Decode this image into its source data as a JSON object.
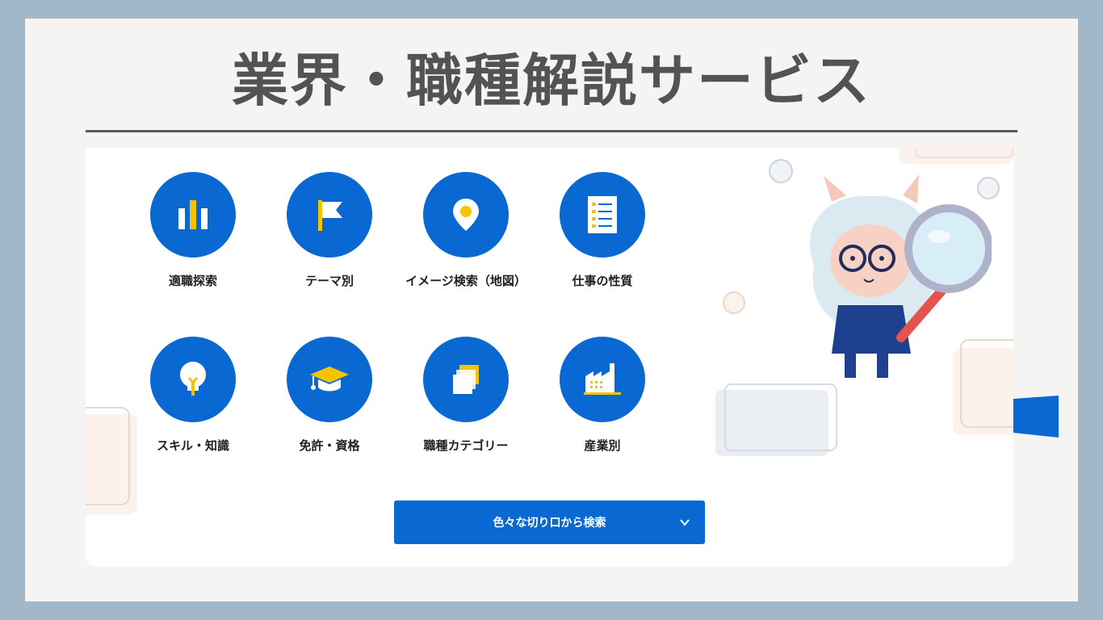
{
  "title": "業界・職種解説サービス",
  "tiles": [
    {
      "label": "適職探索",
      "icon": "bar-chart-icon"
    },
    {
      "label": "テーマ別",
      "icon": "flag-icon"
    },
    {
      "label": "イメージ検索（地図）",
      "icon": "map-pin-icon"
    },
    {
      "label": "仕事の性質",
      "icon": "checklist-icon"
    },
    {
      "label": "スキル・知識",
      "icon": "lightbulb-icon"
    },
    {
      "label": "免許・資格",
      "icon": "graduation-cap-icon"
    },
    {
      "label": "職種カテゴリー",
      "icon": "stacked-squares-icon"
    },
    {
      "label": "産業別",
      "icon": "factory-icon"
    }
  ],
  "cta": {
    "label": "色々な切り口から検索",
    "icon": "chevron-down-icon"
  },
  "colors": {
    "accent": "#0a68d2",
    "yellow": "#f5c400",
    "frame": "#a2b7c7",
    "title": "#535353"
  }
}
